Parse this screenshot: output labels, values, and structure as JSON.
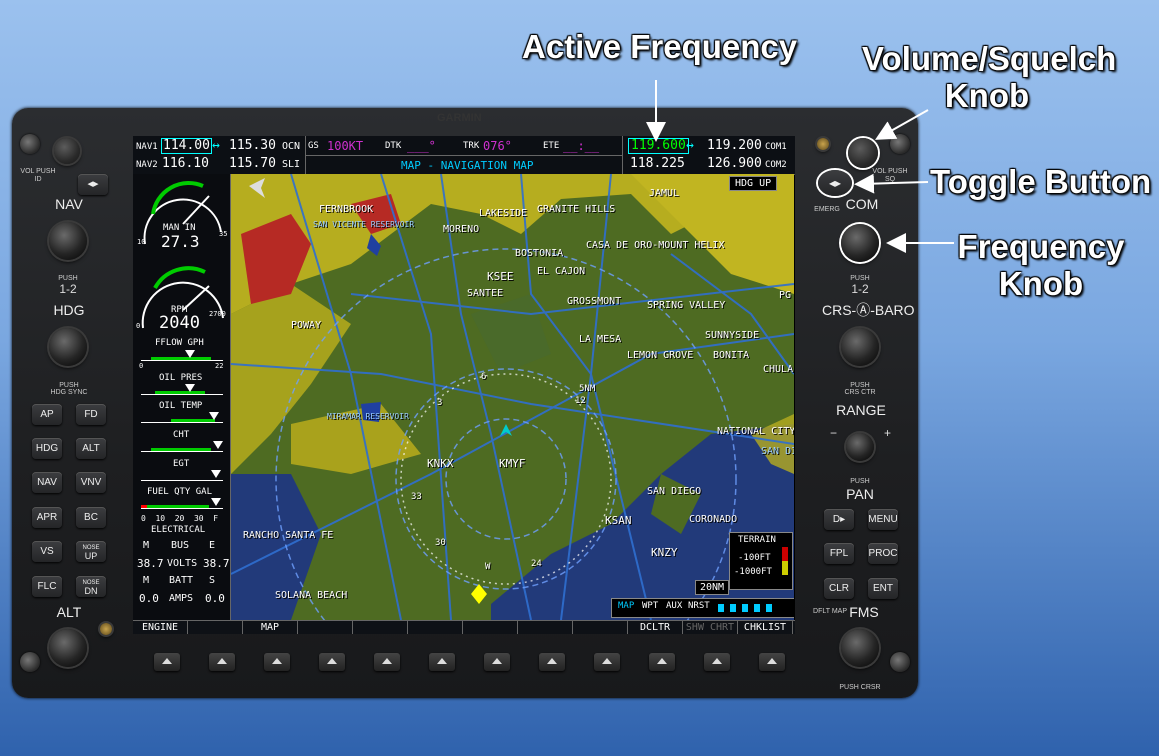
{
  "callouts": {
    "active_frequency": "Active Frequency",
    "volume_line1": "Volume/Squelch",
    "volume_line2": "Knob",
    "toggle_button": "Toggle Button",
    "frequency_line1": "Frequency",
    "frequency_line2": "Knob"
  },
  "bezel": {
    "brand": "GARMIN",
    "left": {
      "vol_push_id": "VOL PUSH ID",
      "nav_label": "NAV",
      "nav_push": "PUSH",
      "nav_12": "1-2",
      "hdg_label": "HDG",
      "hdg_push": "PUSH",
      "hdg_sync": "HDG SYNC",
      "alt_label": "ALT"
    },
    "ap_buttons": {
      "ap": "AP",
      "fd": "FD",
      "hdg": "HDG",
      "alt": "ALT",
      "nav": "NAV",
      "vnv": "VNV",
      "apr": "APR",
      "bc": "BC",
      "vs": "VS",
      "nose_up_1": "NOSE",
      "nose_up_2": "UP",
      "flc": "FLC",
      "nose_dn_1": "NOSE",
      "nose_dn_2": "DN"
    },
    "right": {
      "vol_push_sq": "VOL PUSH SQ",
      "emerg": "EMERG",
      "com_label": "COM",
      "com_push": "PUSH",
      "com_12": "1-2",
      "crs_baro": "CRS-Ⓐ-BARO",
      "push_crs_ctr_1": "PUSH",
      "push_crs_ctr_2": "CRS CTR",
      "range": "RANGE",
      "pan_push": "PUSH",
      "pan": "PAN",
      "direct_to": "D▸",
      "menu": "MENU",
      "fpl": "FPL",
      "proc": "PROC",
      "clr": "CLR",
      "ent": "ENT",
      "dflt_map": "DFLT MAP",
      "fms": "FMS",
      "push_crsr": "PUSH CRSR"
    }
  },
  "topbar": {
    "nav1_label": "NAV1",
    "nav1_active": "114.00",
    "nav1_standby": "115.30",
    "nav1_id": "OCN",
    "nav2_label": "NAV2",
    "nav2_active": "116.10",
    "nav2_standby": "115.70",
    "nav2_id": "SLI",
    "gs_label": "GS",
    "gs_value": "100KT",
    "dtk_label": "DTK",
    "dtk_value": "___°",
    "trk_label": "TRK",
    "trk_value": "076°",
    "ete_label": "ETE",
    "ete_value": "__:__",
    "page_title": "MAP - NAVIGATION MAP",
    "com1_active": "119.600",
    "com1_standby": "119.200",
    "com1_label": "COM1",
    "com2_active": "118.225",
    "com2_standby": "126.900",
    "com2_label": "COM2",
    "swap_arrow": "↔"
  },
  "eis": {
    "man_in": "MAN IN",
    "man_in_value": "27.3",
    "man_min": "10",
    "man_max": "35",
    "rpm": "RPM",
    "rpm_value": "2040",
    "rpm_min": "0",
    "rpm_max": "2700",
    "fflow": "FFLOW GPH",
    "fflow_min": "0",
    "fflow_max": "22",
    "oil_pres": "OIL PRES",
    "oil_temp": "OIL TEMP",
    "cht": "CHT",
    "egt": "EGT",
    "fuel_qty": "FUEL QTY GAL",
    "fuel_ticks": "0  10  20  30  F",
    "electrical": "ELECTRICAL",
    "bus_m": "M",
    "bus": "BUS",
    "bus_e": "E",
    "volts_m": "38.7",
    "volts": "VOLTS",
    "volts_e": "38.7",
    "batt_m": "M",
    "batt": "BATT",
    "batt_s": "S",
    "amps_m": "0.0",
    "amps": "AMPS",
    "amps_s": "0.0"
  },
  "map": {
    "orientation": "HDG UP",
    "range": "20NM",
    "terrain_title": "TERRAIN",
    "terrain_1": "-100FT",
    "terrain_2": "-1000FT",
    "map_tabs": [
      "MAP",
      "WPT",
      "AUX",
      "NRST"
    ],
    "cities": {
      "fernbrook": "FERNBROOK",
      "lakeside": "LAKESIDE",
      "granite_hills": "GRANITE HILLS",
      "jamul": "JAMUL",
      "san_vicente": "SAN VICENTE RESERVOIR",
      "moreno": "MORENO",
      "bostonia": "BOSTONIA",
      "casa_de_oro": "CASA DE ORO-MOUNT HELIX",
      "ksee": "KSEE",
      "el_cajon": "EL CAJON",
      "santee": "SANTEE",
      "grossmont": "GROSSMONT",
      "spring_valley": "SPRING VALLEY",
      "poway": "POWAY",
      "sunnyside": "SUNNYSIDE",
      "la_mesa": "LA MESA",
      "lemon_grove": "LEMON GROVE",
      "bonita": "BONITA",
      "chula": "CHULA",
      "miramar": "MIRAMAR RESERVOIR",
      "national_city": "NATIONAL CITY",
      "knkx": "KNKX",
      "kmyf": "KMYF",
      "san_diego": "SAN DIEGO",
      "ksan": "KSAN",
      "coronado": "CORONADO",
      "knzy": "KNZY",
      "rancho": "RANCHO SANTA FE",
      "solana": "SOLANA BEACH",
      "pg": "PG",
      "san_di": "SAN DI"
    },
    "range_marks": {
      "r5": "5NM",
      "r12": "12",
      "r33": "33",
      "r30": "30",
      "r3": "3",
      "r6": "6",
      "r24": "24",
      "w": "W"
    }
  },
  "softkeys": [
    "ENGINE",
    "",
    "MAP",
    "",
    "",
    "",
    "",
    "",
    "",
    "DCLTR",
    "SHW CHRT",
    "CHKLIST"
  ]
}
